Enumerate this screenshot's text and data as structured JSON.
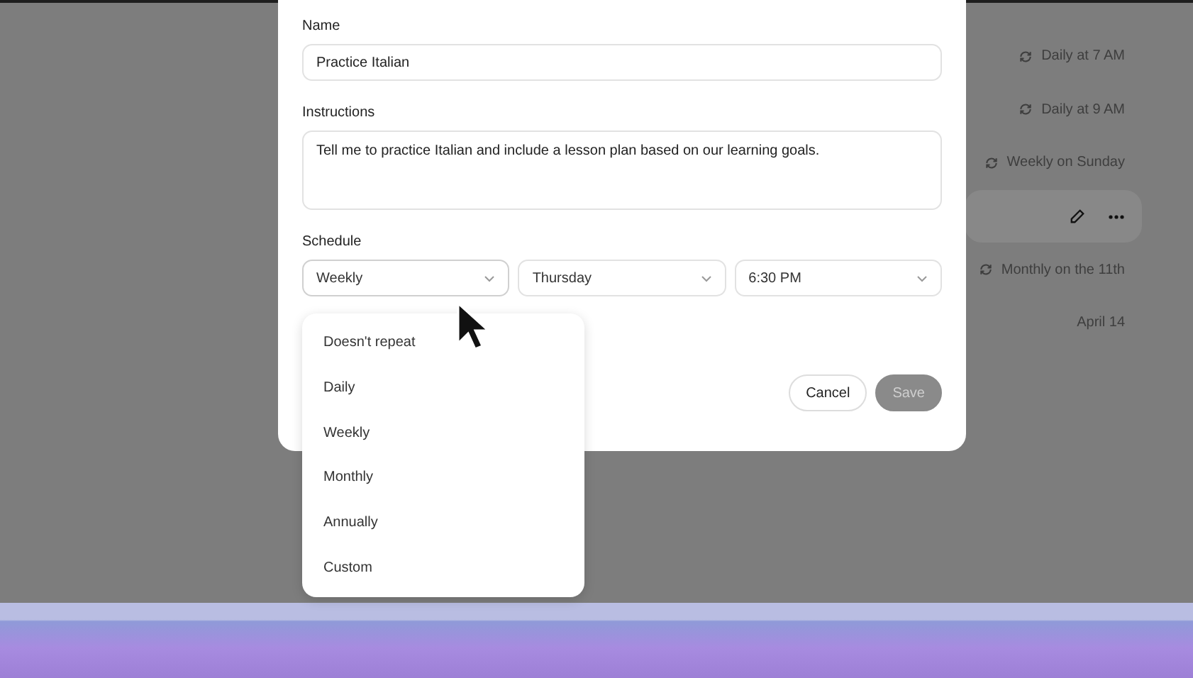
{
  "background_list": [
    {
      "schedule": "Daily at 7 AM",
      "hovered": false
    },
    {
      "schedule": "Daily at 9 AM",
      "hovered": false
    },
    {
      "schedule": "Weekly on Sunday",
      "hovered": false
    },
    {
      "hovered": true
    },
    {
      "schedule": "Monthly on the 11th",
      "hovered": false
    },
    {
      "date": "April 14",
      "hovered": false
    }
  ],
  "dialog": {
    "name": {
      "label": "Name",
      "value": "Practice Italian"
    },
    "instructions": {
      "label": "Instructions",
      "value": "Tell me to practice Italian and include a lesson plan based on our learning goals."
    },
    "schedule": {
      "label": "Schedule",
      "selects": [
        {
          "value": "Weekly",
          "open": true
        },
        {
          "value": "Thursday",
          "open": false
        },
        {
          "value": "6:30 PM",
          "open": false
        }
      ],
      "options": [
        {
          "label": "Doesn't repeat"
        },
        {
          "label": "Daily"
        },
        {
          "label": "Weekly"
        },
        {
          "label": "Monthly"
        },
        {
          "label": "Annually"
        },
        {
          "label": "Custom"
        }
      ]
    },
    "buttons": [
      {
        "label": "Cancel",
        "kind": "secondary",
        "disabled": false
      },
      {
        "label": "Save",
        "kind": "primary",
        "disabled": true
      }
    ]
  }
}
